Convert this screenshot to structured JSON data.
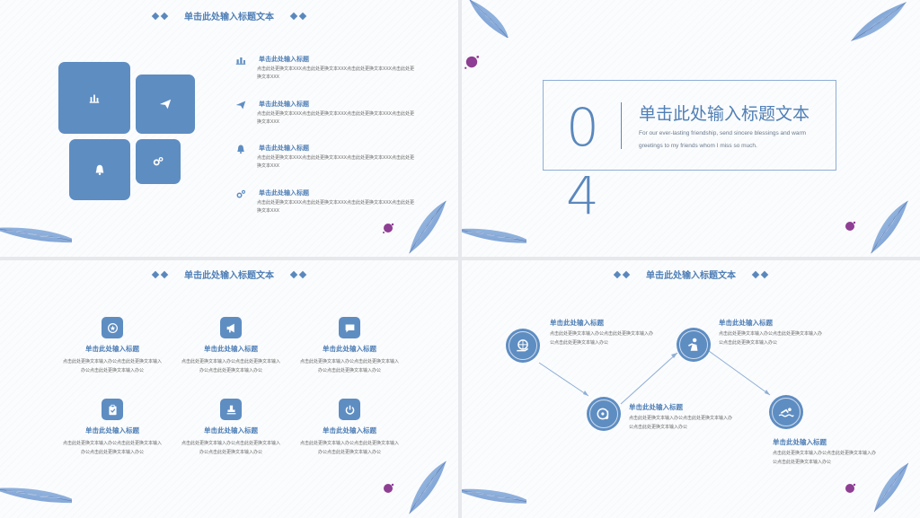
{
  "header_title": "单击此处输入标题文本",
  "slide1": {
    "items": [
      {
        "title": "单击此处输入标题",
        "desc": "点击此处更换文本XXX点击此处更换文本XXX点击此处更换文本XXX点击此处更换文本XXX"
      },
      {
        "title": "单击此处输入标题",
        "desc": "点击此处更换文本XXX点击此处更换文本XXX点击此处更换文本XXX点击此处更换文本XXX"
      },
      {
        "title": "单击此处输入标题",
        "desc": "点击此处更换文本XXX点击此处更换文本XXX点击此处更换文本XXX点击此处更换文本XXX"
      },
      {
        "title": "单击此处输入标题",
        "desc": "点击此处更换文本XXX点击此处更换文本XXX点击此处更换文本XXX点击此处更换文本XXX"
      }
    ],
    "tile_icons": [
      "bar-chart-icon",
      "paper-plane-icon",
      "bell-icon",
      "gears-icon"
    ]
  },
  "slide2": {
    "number_top": "0",
    "number_bottom": "4",
    "title": "单击此处输入标题文本",
    "subtitle": "For our ever-lasting friendship, send sincere blessings and warm greetings to my friends whom I miss so much."
  },
  "slide3": {
    "items": [
      {
        "icon": "star-badge-icon",
        "title": "单击此处输入标题",
        "desc": "点击此处更换文本输入办公点击此处更换文本输入办公点击此处更换文本输入办公"
      },
      {
        "icon": "megaphone-icon",
        "title": "单击此处输入标题",
        "desc": "点击此处更换文本输入办公点击此处更换文本输入办公点击此处更换文本输入办公"
      },
      {
        "icon": "chat-bubble-icon",
        "title": "单击此处输入标题",
        "desc": "点击此处更换文本输入办公点击此处更换文本输入办公点击此处更换文本输入办公"
      },
      {
        "icon": "clipboard-icon",
        "title": "单击此处输入标题",
        "desc": "点击此处更换文本输入办公点击此处更换文本输入办公点击此处更换文本输入办公"
      },
      {
        "icon": "stamp-icon",
        "title": "单击此处输入标题",
        "desc": "点击此处更换文本输入办公点击此处更换文本输入办公点击此处更换文本输入办公"
      },
      {
        "icon": "power-icon",
        "title": "单击此处输入标题",
        "desc": "点击此处更换文本输入办公点击此处更换文本输入办公点击此处更换文本输入办公"
      }
    ]
  },
  "slide4": {
    "nodes": [
      {
        "icon": "globe-hand-icon",
        "title": "单击此处输入标题",
        "desc": "点击此处更换文本输入办公点击此处更换文本输入办公点击此处更换文本输入办公"
      },
      {
        "icon": "music-disc-icon",
        "title": "单击此处输入标题",
        "desc": "点击此处更换文本输入办公点击此处更换文本输入办公点击此处更换文本输入办公"
      },
      {
        "icon": "person-reading-icon",
        "title": "单击此处输入标题",
        "desc": "点击此处更换文本输入办公点击此处更换文本输入办公点击此处更换文本输入办公"
      },
      {
        "icon": "swimmer-icon",
        "title": "单击此处输入标题",
        "desc": "点击此处更换文本输入办公点击此处更换文本输入办公点击此处更换文本输入办公"
      }
    ]
  },
  "colors": {
    "accent": "#5a88bd",
    "tile": "#5e8dc2",
    "ink_splash": "#8e3f93"
  }
}
